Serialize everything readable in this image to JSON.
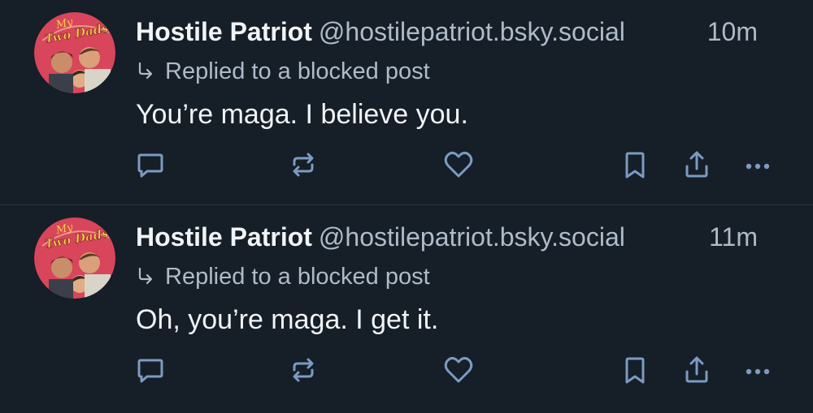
{
  "posts": [
    {
      "avatar_text": "My Two Dads",
      "display_name": "Hostile Patriot",
      "handle": "@hostilepatriot.bsky.social",
      "timestamp": "10m",
      "reply_context": "Replied to a blocked post",
      "text": "You’re maga. I believe you."
    },
    {
      "avatar_text": "My Two Dads",
      "display_name": "Hostile Patriot",
      "handle": "@hostilepatriot.bsky.social",
      "timestamp": "11m",
      "reply_context": "Replied to a blocked post",
      "text": "Oh, you’re maga. I get it."
    }
  ],
  "icons": {
    "reply_context": "reply-arrow-icon",
    "actions": [
      "reply-icon",
      "repost-icon",
      "like-heart-icon",
      "bookmark-icon",
      "share-icon",
      "more-options-icon"
    ]
  },
  "colors": {
    "background": "#161e27",
    "primary_text": "#f1f3f5",
    "secondary_text": "#aebbc9",
    "avatar_background": "#d9455b",
    "avatar_logo": "#f5d04a"
  }
}
